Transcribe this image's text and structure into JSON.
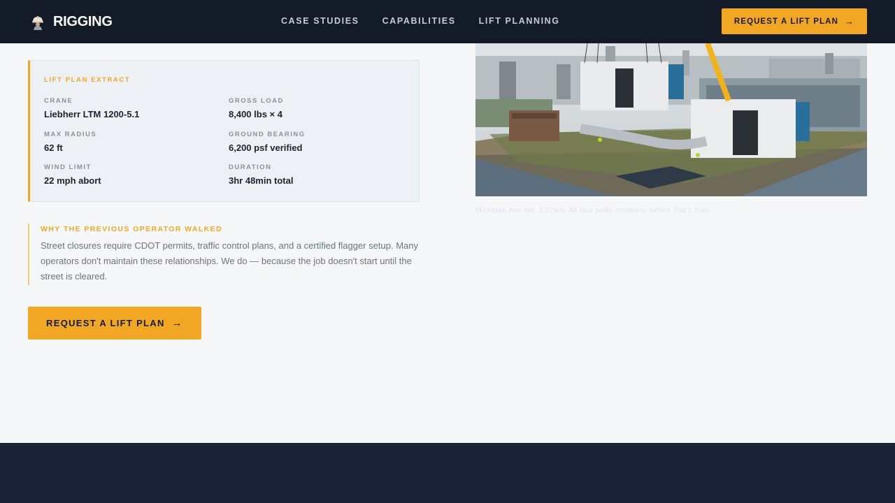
{
  "header": {
    "brand": "RIGGING",
    "nav": [
      "CASE STUDIES",
      "CAPABILITIES",
      "LIFT PLANNING"
    ],
    "cta_label": "REQUEST A LIFT PLAN",
    "cta_icon": "arrow-right-icon"
  },
  "lift_plan": {
    "title": "LIFT PLAN EXTRACT",
    "specs": [
      {
        "label": "CRANE",
        "value": "Liebherr LTM 1200-5.1"
      },
      {
        "label": "GROSS LOAD",
        "value": "8,400 lbs × 4"
      },
      {
        "label": "MAX RADIUS",
        "value": "62 ft"
      },
      {
        "label": "GROUND BEARING",
        "value": "6,200 psf verified"
      },
      {
        "label": "WIND LIMIT",
        "value": "22 mph abort"
      },
      {
        "label": "DURATION",
        "value": "3hr 48min total"
      }
    ]
  },
  "why": {
    "title": "WHY THE PREVIOUS OPERATOR WALKED",
    "body": "Street closures require CDOT permits, traffic control plans, and a certified flagger setup. Many operators don't maintain these relationships. We do — because the job doesn't start until the street is cleared."
  },
  "cta_main": {
    "label": "REQUEST A LIFT PLAN",
    "icon": "arrow-right-icon"
  },
  "photo": {
    "caption": "Michigan Ave set, 3:22am. All four picks complete before first L train."
  },
  "colors": {
    "accent": "#f2a724",
    "header_bg": "#141b28",
    "footer_bg": "#1b2436",
    "page_bg": "#f5f7f9"
  }
}
